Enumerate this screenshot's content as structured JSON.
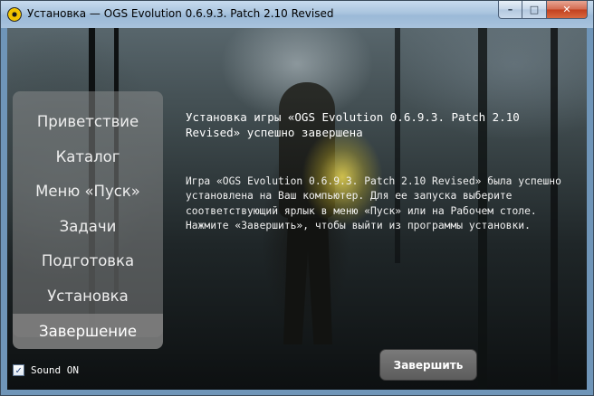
{
  "window": {
    "title": "Установка — OGS Evolution 0.6.9.3. Patch 2.10 Revised",
    "app_icon": "radiation-icon",
    "controls": {
      "minimize": "–",
      "maximize": "□",
      "close": "✕"
    }
  },
  "sidebar": {
    "items": [
      {
        "label": "Приветствие",
        "active": false
      },
      {
        "label": "Каталог",
        "active": false
      },
      {
        "label": "Меню «Пуск»",
        "active": false
      },
      {
        "label": "Задачи",
        "active": false
      },
      {
        "label": "Подготовка",
        "active": false
      },
      {
        "label": "Установка",
        "active": false
      },
      {
        "label": "Завершение",
        "active": true
      }
    ]
  },
  "main": {
    "heading": "Установка игры «OGS Evolution 0.6.9.3. Patch 2.10 Revised» успешно завершена",
    "message": "Игра «OGS Evolution 0.6.9.3. Patch 2.10 Revised» была успешно установлена на Ваш компьютер. Для ее запуска выберите соответствующий ярлык в меню «Пуск» или на Рабочем столе. Нажмите «Завершить», чтобы выйти из программы установки."
  },
  "footer": {
    "sound_label": "Sound ON",
    "sound_checked": true,
    "finish_label": "Завершить"
  }
}
